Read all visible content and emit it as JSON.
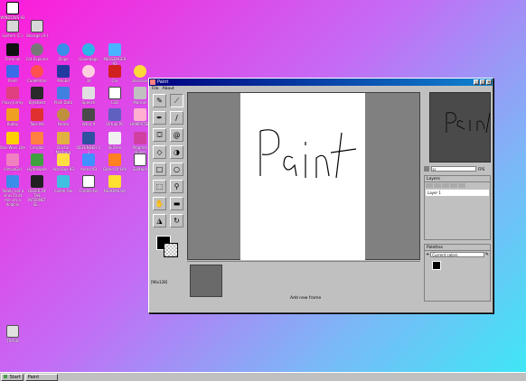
{
  "desktop": {
    "top_icons": [
      {
        "label": "WINDOWS 93"
      },
      {
        "label": "System (C:)"
      },
      {
        "label": "Storage (A:)"
      }
    ],
    "icons_row1": [
      "Terminal",
      "Cat Explorer",
      "Zlope",
      "Glaxedago",
      "MESSENGER 93"
    ],
    "icons_row2": [
      "Paint",
      "CodeMirror",
      "MiniEd",
      "3d",
      "Car",
      "Bananas"
    ],
    "icons_row3": [
      "Pixxy Jorrey",
      "ByteBeat",
      "Pixel Data",
      "Speech",
      "LSD",
      "Manrun"
    ],
    "icons_row4": [
      "Robby",
      "Take Me",
      "Potato",
      "What If",
      "Virtual PC",
      "HAMPSTER"
    ],
    "icons_row5": [
      "Star Wars Lite",
      "Cerglob",
      "Doctor Marburg",
      "DEFENDER 3 1",
      "SkiFree",
      "Progress Quest"
    ],
    "icons_row6": [
      "VirtualGirl",
      "Hydraware",
      "Acid Box 93",
      "Arena 93",
      "Game Of Life",
      "Solitaire"
    ],
    "icons_row7": [
      "Totally not a virus.Trust me..im a dolphin",
      "OLDER OF THE INTERNET SE...",
      "Castle Fox",
      "Credits.txt",
      "README.txt"
    ],
    "trash_label": "TRASH"
  },
  "window": {
    "title": "Paint",
    "menu": [
      "File",
      "About"
    ],
    "canvas_text": "Paint",
    "coords": "[96x128]",
    "add_frame": "Add new frame",
    "zoom_value": "12",
    "fps_label": "FPS",
    "layers_title": "Layers",
    "layer_name": "Layer 1",
    "palettes_title": "Palettes",
    "palette_select": "Current colors"
  },
  "taskbar": {
    "start": "Start",
    "task": "Paint"
  }
}
